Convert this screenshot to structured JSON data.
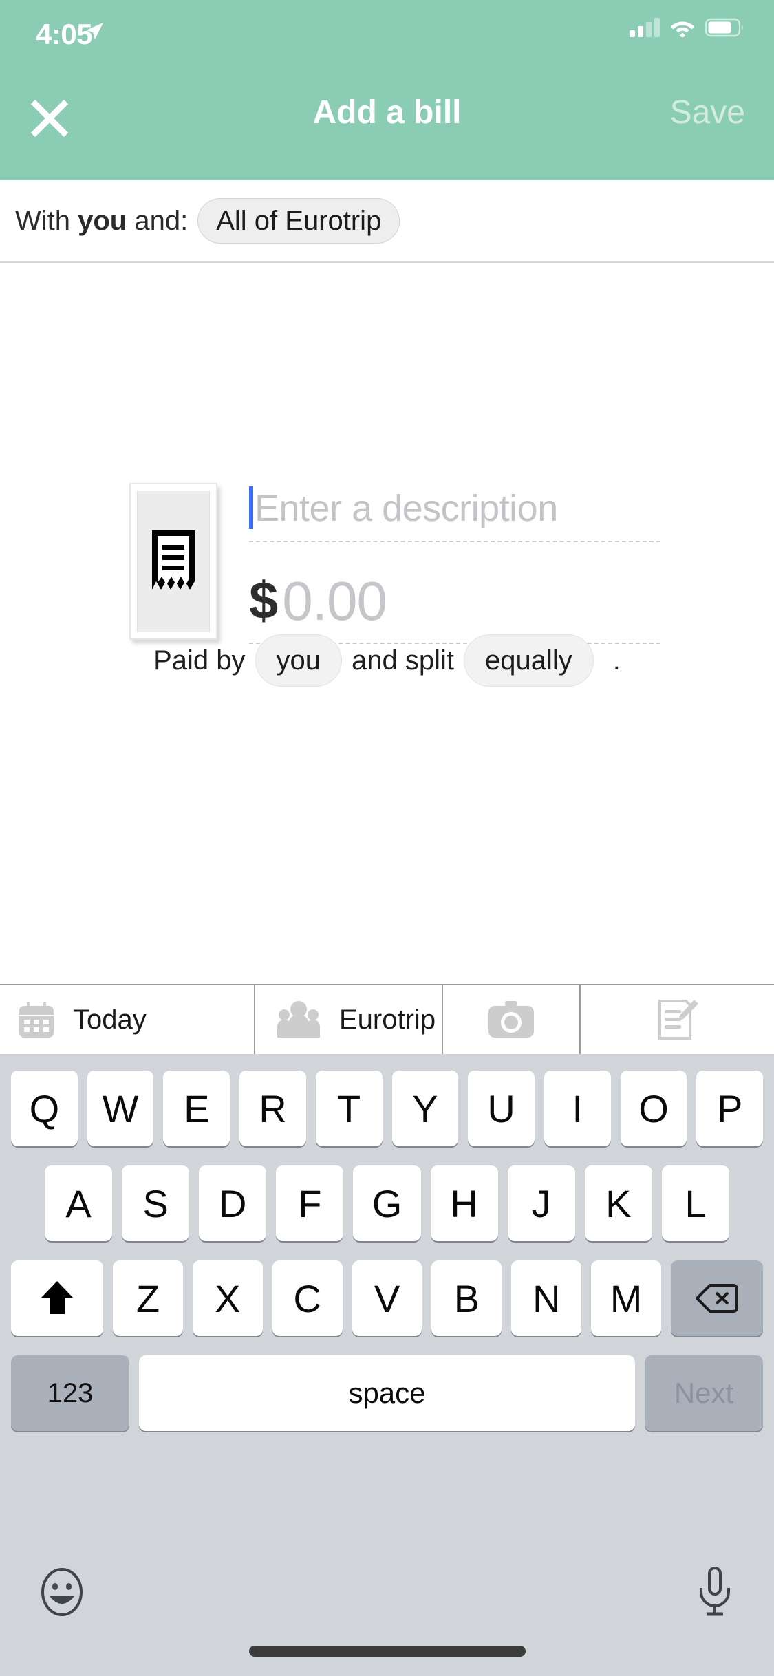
{
  "status_bar": {
    "time": "4:05",
    "location_icon": "location-arrow-icon",
    "signal_icon": "cellular-signal-icon",
    "signal_bars_filled": 2,
    "signal_bars_total": 4,
    "wifi_icon": "wifi-icon",
    "battery_icon": "battery-icon",
    "battery_level_pct": 75
  },
  "nav_bar": {
    "close_icon": "close-x-icon",
    "title": "Add a bill",
    "save_label": "Save",
    "background_color": "#8BCCB4",
    "title_color": "#FFFFFF",
    "save_color": "#FFFFFF9E"
  },
  "with_row": {
    "prefix": "With ",
    "you_label": "you",
    "suffix": " and:",
    "group_chip_label": "All of Eurotrip"
  },
  "form": {
    "receipt_icon": "receipt-icon",
    "description_placeholder": "Enter a description",
    "caret_color": "#3B6DFB",
    "currency_symbol": "$",
    "amount_placeholder": "0.00",
    "paid_by_prefix": "Paid by",
    "paid_by_chip": "you",
    "split_text": "and split",
    "split_chip": "equally",
    "period": "."
  },
  "toolbar": {
    "items": [
      {
        "icon": "calendar-icon",
        "label": "Today"
      },
      {
        "icon": "group-people-icon",
        "label": "Eurotrip"
      },
      {
        "icon": "camera-icon",
        "label": ""
      },
      {
        "icon": "notes-edit-icon",
        "label": ""
      }
    ]
  },
  "keyboard": {
    "row1": [
      "Q",
      "W",
      "E",
      "R",
      "T",
      "Y",
      "U",
      "I",
      "O",
      "P"
    ],
    "row2": [
      "A",
      "S",
      "D",
      "F",
      "G",
      "H",
      "J",
      "K",
      "L"
    ],
    "row3": [
      "Z",
      "X",
      "C",
      "V",
      "B",
      "N",
      "M"
    ],
    "shift_icon": "shift-arrow-icon",
    "backspace_icon": "backspace-icon",
    "numeric_label": "123",
    "space_label": "space",
    "return_label": "Next",
    "emoji_icon": "emoji-smiley-icon",
    "dictation_icon": "microphone-icon",
    "background_color": "#D1D5DA"
  }
}
